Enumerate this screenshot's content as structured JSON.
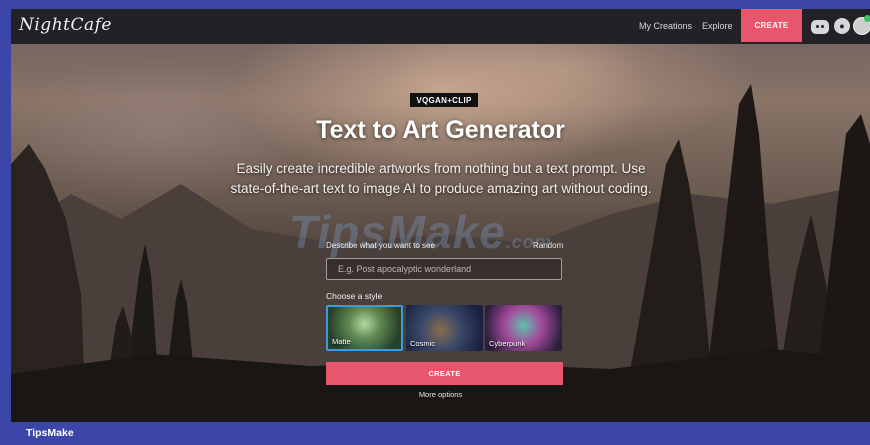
{
  "brand": {
    "logo_text": "NightCafe"
  },
  "nav": {
    "my_creations": "My Creations",
    "explore": "Explore",
    "create": "CREATE",
    "icons": [
      "discord-icon",
      "bell-icon",
      "avatar"
    ]
  },
  "hero": {
    "badge": "VQGAN+CLIP",
    "title": "Text to Art Generator",
    "subtitle": "Easily create incredible artworks from nothing but a text prompt. Use state-of-the-art text to image AI to produce amazing art without coding."
  },
  "form": {
    "prompt_label": "Describe what you want to see",
    "random_link": "Random",
    "prompt_placeholder": "E.g. Post apocalyptic wonderland",
    "prompt_value": "",
    "style_label": "Choose a style",
    "styles": [
      {
        "name": "Matte",
        "selected": true
      },
      {
        "name": "Cosmic",
        "selected": false
      },
      {
        "name": "Cyberpunk",
        "selected": false
      }
    ],
    "create_button": "CREATE",
    "more_options": "More options"
  },
  "watermark": {
    "text": "TipsMake",
    "suffix": ".com"
  },
  "footer": {
    "brand": "TipsMake"
  },
  "colors": {
    "accent": "#e7566d",
    "navbar": "#222126",
    "frame": "#3c46a8",
    "selected_border": "#3b9ae0"
  }
}
